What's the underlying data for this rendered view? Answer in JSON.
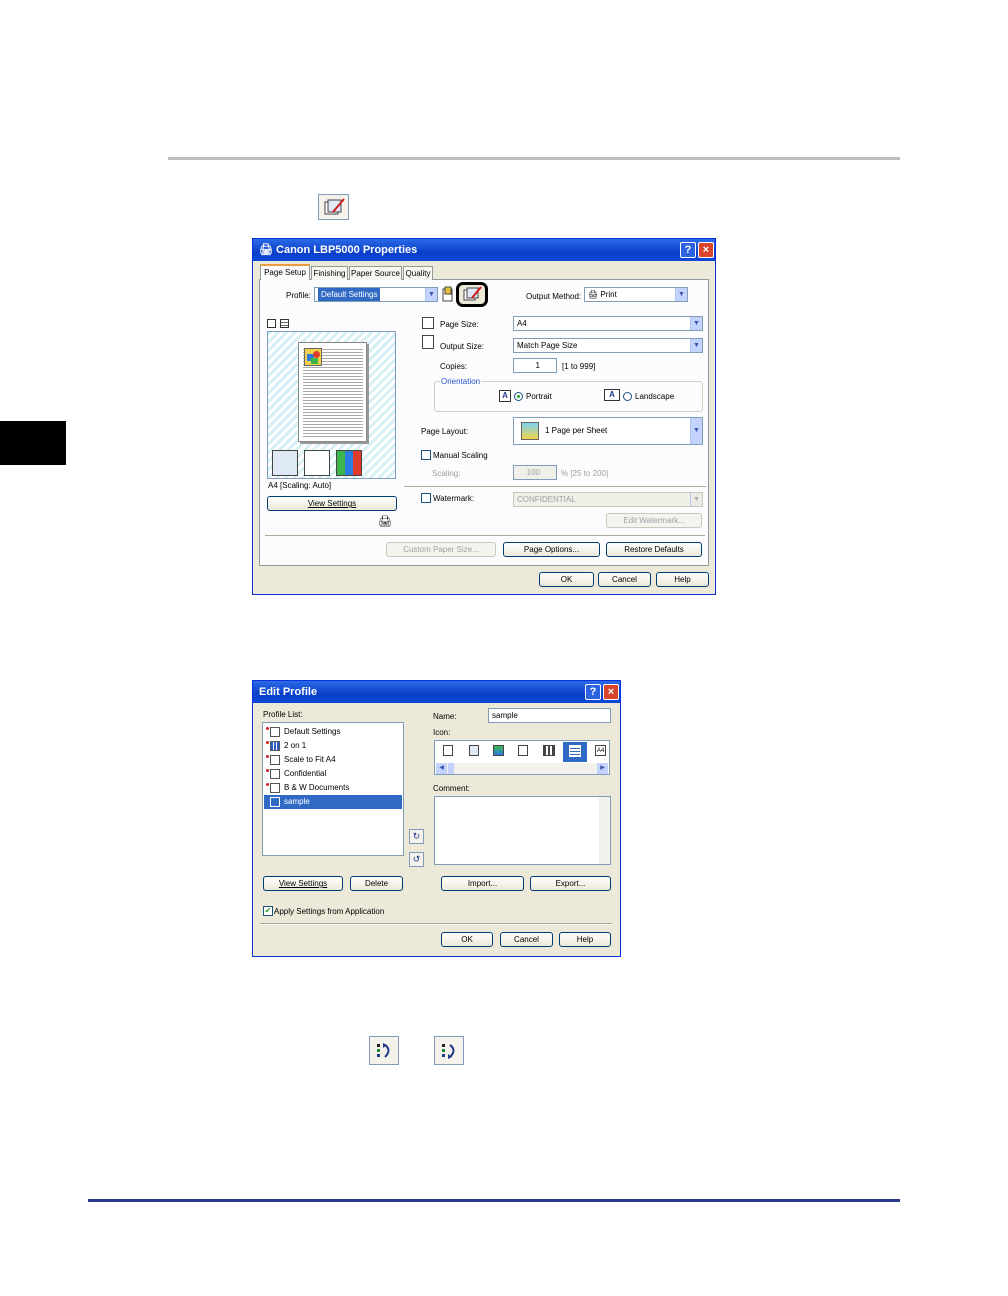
{
  "props": {
    "title": "Canon LBP5000 Properties",
    "help_btn": "?",
    "close_btn": "×",
    "tabs": [
      "Page Setup",
      "Finishing",
      "Paper Source",
      "Quality"
    ],
    "profile_label": "Profile:",
    "profile_value": "Default Settings",
    "output_method_label": "Output Method:",
    "output_method_value": "Print",
    "page_size_label": "Page Size:",
    "page_size_value": "A4",
    "output_size_label": "Output Size:",
    "output_size_value": "Match Page Size",
    "copies_label": "Copies:",
    "copies_value": "1",
    "copies_range": "[1 to 999]",
    "orientation_label": "Orientation",
    "portrait": "Portrait",
    "landscape": "Landscape",
    "page_layout_label": "Page Layout:",
    "page_layout_value": "1 Page per Sheet",
    "manual_scaling": "Manual Scaling",
    "scaling_label": "Scaling:",
    "scaling_value": "100",
    "scaling_range": "% [25 to 200]",
    "watermark_label": "Watermark:",
    "watermark_value": "CONFIDENTIAL",
    "edit_watermark": "Edit Watermark...",
    "preview_caption": "A4 [Scaling: Auto]",
    "view_settings": "View Settings",
    "custom_paper_size": "Custom Paper Size...",
    "page_options": "Page Options...",
    "restore_defaults": "Restore Defaults",
    "ok": "OK",
    "cancel": "Cancel",
    "help": "Help"
  },
  "edit": {
    "title": "Edit Profile",
    "help_btn": "?",
    "close_btn": "×",
    "profile_list_label": "Profile List:",
    "profiles": [
      "Default Settings",
      "2 on 1",
      "Scale to Fit A4",
      "Confidential",
      "B & W Documents",
      "sample"
    ],
    "selected_index": 5,
    "name_label": "Name:",
    "name_value": "sample",
    "icon_label": "Icon:",
    "comment_label": "Comment:",
    "view_settings": "View Settings",
    "delete": "Delete",
    "import": "Import...",
    "export": "Export...",
    "apply_settings": "Apply Settings from Application",
    "ok": "OK",
    "cancel": "Cancel",
    "help": "Help"
  }
}
